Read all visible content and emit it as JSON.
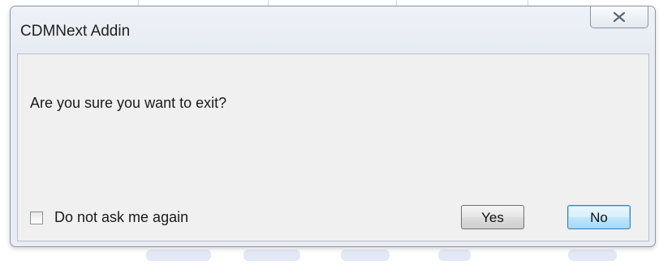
{
  "dialog": {
    "title": "CDMNext Addin",
    "close_icon": "close-icon",
    "message": "Are you sure you want to exit?",
    "checkbox": {
      "label": "Do not ask me again",
      "checked": false
    },
    "buttons": {
      "yes_label": "Yes",
      "no_label": "No"
    }
  },
  "colors": {
    "frame": "#e9ecf2",
    "client": "#f0f0f0",
    "default_button_border": "#3c7fb1"
  }
}
